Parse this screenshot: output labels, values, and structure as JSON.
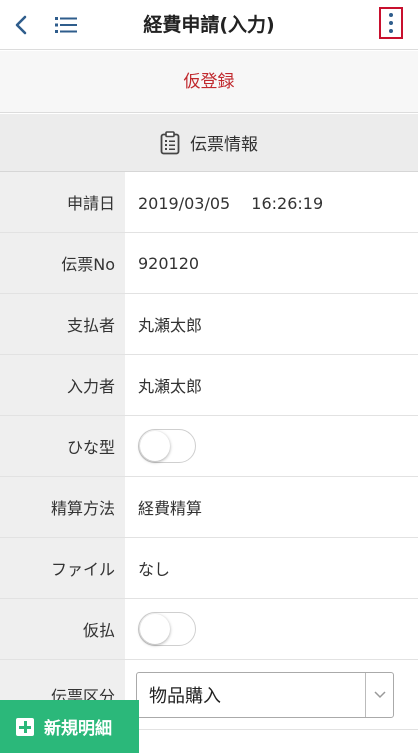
{
  "header": {
    "title": "経費申請(入力)",
    "back_icon": "chevron-left-icon",
    "list_icon": "list-icon",
    "more_icon": "more-vertical-icon"
  },
  "provisional_register": "仮登録",
  "section": {
    "title": "伝票情報",
    "icon": "clipboard-icon"
  },
  "fields": {
    "application_date": {
      "label": "申請日",
      "value": "2019/03/05　 16:26:19"
    },
    "slip_no": {
      "label": "伝票No",
      "value": "920120"
    },
    "payer": {
      "label": "支払者",
      "value": "丸瀬太郎"
    },
    "entered_by": {
      "label": "入力者",
      "value": "丸瀬太郎"
    },
    "template": {
      "label": "ひな型",
      "on": false
    },
    "settlement_method": {
      "label": "精算方法",
      "value": "経費精算"
    },
    "file": {
      "label": "ファイル",
      "value": "なし"
    },
    "provisional_payment": {
      "label": "仮払",
      "on": false
    },
    "slip_category": {
      "label": "伝票区分",
      "value": "物品購入"
    }
  },
  "new_detail_button": {
    "label": "新規明細",
    "icon": "plus-square-icon"
  },
  "colors": {
    "accent_red": "#c0282d",
    "nav_blue": "#2f5d8c",
    "button_green": "#2bb87a",
    "label_bg": "#efefef"
  }
}
